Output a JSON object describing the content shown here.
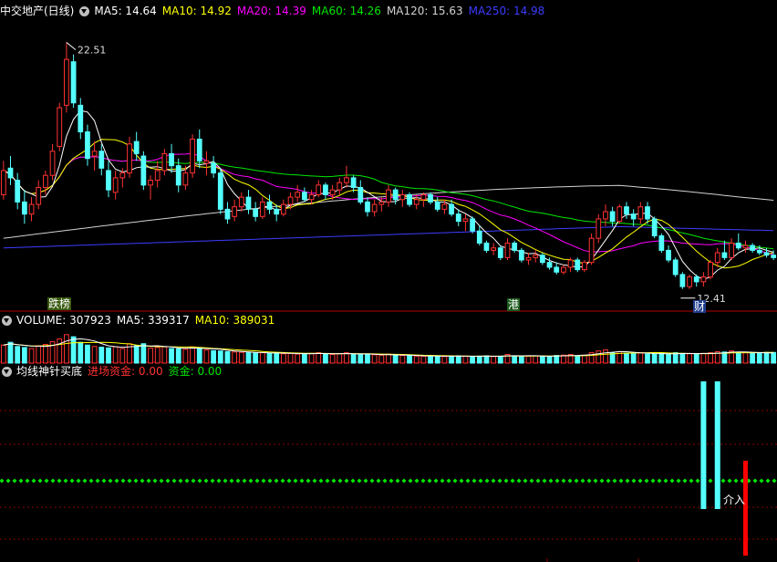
{
  "colors": {
    "up": "#ff3232",
    "down": "#54ffff",
    "grid": "#8b0000",
    "ma5": "#ffffff",
    "ma10": "#ffff00",
    "ma20": "#ff00ff",
    "ma60": "#00e600",
    "ma120": "#d2d2d2",
    "ma250": "#3c3cff",
    "dots": "#00e600"
  },
  "price_panel": {
    "title": "中交地产(日线)",
    "ma5": "MA5: 14.64",
    "ma10": "MA10: 14.92",
    "ma20": "MA20: 14.39",
    "ma60": "MA60: 14.26",
    "ma120": "MA120: 15.63",
    "ma250": "MA250: 14.98",
    "high_label": "22.51",
    "low_label": "12.41",
    "tag1": "跌榜",
    "tag2": "港",
    "tag3": "财"
  },
  "volume_panel": {
    "vol": "VOLUME: 307923",
    "ma5": "MA5: 339317",
    "ma10": "MA10: 389031"
  },
  "indicator_panel": {
    "name": "均线神针买底",
    "in_fund": "进场资金: 0.00",
    "fund": "资金: 0.00",
    "buy_label": "介入"
  },
  "chart_data": [
    {
      "type": "candlestick",
      "title": "中交地产(日线)",
      "ylim": [
        11.5,
        23.5
      ],
      "candles": [
        [
          16.2,
          17.6,
          16.0,
          17.2
        ],
        [
          17.3,
          17.8,
          16.6,
          16.9
        ],
        [
          16.8,
          17.1,
          15.6,
          15.9
        ],
        [
          15.9,
          16.4,
          15.0,
          15.4
        ],
        [
          15.4,
          16.1,
          15.1,
          15.8
        ],
        [
          15.8,
          16.8,
          15.6,
          16.5
        ],
        [
          16.5,
          17.2,
          16.2,
          17.0
        ],
        [
          17.0,
          18.3,
          16.8,
          18.0
        ],
        [
          18.2,
          20.0,
          18.0,
          19.8
        ],
        [
          19.9,
          22.5,
          19.6,
          21.8
        ],
        [
          21.7,
          22.0,
          19.8,
          20.0
        ],
        [
          19.9,
          20.2,
          18.5,
          18.8
        ],
        [
          18.8,
          19.1,
          17.4,
          17.7
        ],
        [
          17.8,
          18.4,
          17.2,
          18.0
        ],
        [
          18.0,
          18.3,
          17.0,
          17.3
        ],
        [
          17.2,
          17.6,
          16.1,
          16.4
        ],
        [
          16.3,
          17.2,
          16.0,
          16.9
        ],
        [
          16.9,
          17.3,
          16.5,
          17.1
        ],
        [
          17.1,
          18.6,
          16.9,
          18.3
        ],
        [
          18.4,
          18.8,
          17.6,
          17.9
        ],
        [
          17.8,
          18.0,
          16.4,
          16.6
        ],
        [
          16.6,
          17.0,
          16.0,
          16.8
        ],
        [
          16.8,
          17.6,
          16.5,
          17.2
        ],
        [
          17.2,
          18.1,
          17.0,
          17.9
        ],
        [
          17.9,
          18.3,
          17.1,
          17.4
        ],
        [
          17.4,
          17.7,
          16.3,
          16.6
        ],
        [
          16.6,
          17.4,
          16.4,
          17.1
        ],
        [
          17.1,
          18.7,
          16.9,
          18.5
        ],
        [
          18.5,
          18.9,
          17.3,
          17.6
        ],
        [
          17.5,
          18.0,
          17.0,
          17.6
        ],
        [
          17.5,
          17.8,
          16.9,
          17.1
        ],
        [
          17.1,
          17.3,
          15.4,
          15.6
        ],
        [
          15.6,
          15.9,
          15.0,
          15.2
        ],
        [
          15.3,
          16.0,
          15.1,
          15.7
        ],
        [
          15.7,
          16.3,
          15.5,
          16.1
        ],
        [
          16.1,
          16.4,
          15.4,
          15.6
        ],
        [
          15.6,
          15.9,
          15.1,
          15.3
        ],
        [
          15.3,
          16.1,
          15.2,
          15.9
        ],
        [
          15.9,
          16.2,
          15.4,
          15.6
        ],
        [
          15.6,
          15.8,
          15.1,
          15.4
        ],
        [
          15.4,
          16.0,
          15.3,
          15.8
        ],
        [
          15.8,
          16.3,
          15.6,
          16.1
        ],
        [
          16.1,
          16.6,
          15.9,
          16.3
        ],
        [
          16.3,
          16.5,
          15.9,
          16.0
        ],
        [
          16.0,
          16.4,
          15.8,
          16.2
        ],
        [
          16.2,
          16.8,
          16.1,
          16.6
        ],
        [
          16.6,
          16.7,
          16.0,
          16.2
        ],
        [
          16.2,
          16.6,
          16.0,
          16.4
        ],
        [
          16.4,
          16.9,
          16.2,
          16.7
        ],
        [
          16.7,
          17.4,
          16.5,
          16.9
        ],
        [
          16.9,
          17.0,
          16.3,
          16.5
        ],
        [
          16.5,
          16.8,
          15.8,
          15.9
        ],
        [
          15.9,
          16.1,
          15.3,
          15.5
        ],
        [
          15.5,
          16.0,
          15.3,
          15.8
        ],
        [
          15.8,
          16.1,
          15.5,
          15.9
        ],
        [
          15.9,
          16.6,
          15.7,
          16.4
        ],
        [
          16.4,
          16.5,
          15.8,
          16.0
        ],
        [
          16.0,
          16.4,
          15.7,
          16.2
        ],
        [
          16.2,
          16.3,
          15.7,
          15.8
        ],
        [
          15.8,
          16.2,
          15.6,
          16.0
        ],
        [
          16.0,
          16.3,
          15.7,
          16.2
        ],
        [
          16.2,
          16.3,
          15.8,
          15.9
        ],
        [
          15.9,
          16.1,
          15.5,
          15.6
        ],
        [
          15.6,
          16.0,
          15.4,
          15.8
        ],
        [
          15.8,
          16.0,
          15.3,
          15.4
        ],
        [
          15.4,
          15.6,
          14.9,
          15.1
        ],
        [
          15.1,
          15.4,
          14.7,
          15.2
        ],
        [
          15.2,
          15.3,
          14.6,
          14.7
        ],
        [
          14.7,
          14.9,
          14.1,
          14.2
        ],
        [
          14.2,
          14.3,
          13.8,
          13.9
        ],
        [
          13.9,
          14.2,
          13.7,
          14.0
        ],
        [
          14.0,
          14.1,
          13.5,
          13.6
        ],
        [
          13.6,
          14.4,
          13.5,
          14.2
        ],
        [
          14.2,
          14.3,
          13.8,
          13.9
        ],
        [
          13.9,
          14.0,
          13.4,
          13.5
        ],
        [
          13.5,
          13.8,
          13.3,
          13.6
        ],
        [
          13.6,
          13.9,
          13.4,
          13.7
        ],
        [
          13.7,
          13.8,
          13.3,
          13.4
        ],
        [
          13.4,
          13.6,
          13.1,
          13.2
        ],
        [
          13.2,
          13.4,
          12.9,
          13.0
        ],
        [
          13.0,
          13.3,
          12.9,
          13.2
        ],
        [
          13.2,
          13.6,
          13.0,
          13.5
        ],
        [
          13.5,
          13.6,
          13.0,
          13.1
        ],
        [
          13.1,
          13.5,
          13.0,
          13.4
        ],
        [
          13.4,
          14.6,
          13.3,
          14.4
        ],
        [
          14.4,
          15.4,
          14.2,
          15.2
        ],
        [
          15.2,
          15.8,
          14.9,
          15.5
        ],
        [
          15.5,
          15.7,
          14.9,
          15.1
        ],
        [
          15.1,
          15.8,
          15.0,
          15.7
        ],
        [
          15.7,
          15.9,
          15.2,
          15.4
        ],
        [
          15.4,
          15.6,
          14.9,
          15.2
        ],
        [
          15.2,
          15.9,
          15.0,
          15.7
        ],
        [
          15.7,
          15.9,
          15.0,
          15.2
        ],
        [
          15.2,
          15.3,
          14.4,
          14.5
        ],
        [
          14.5,
          14.6,
          13.8,
          13.9
        ],
        [
          13.9,
          14.1,
          13.4,
          13.5
        ],
        [
          13.5,
          13.6,
          12.8,
          12.9
        ],
        [
          12.9,
          13.0,
          12.3,
          12.4
        ],
        [
          12.4,
          12.9,
          12.3,
          12.8
        ],
        [
          12.8,
          12.9,
          12.4,
          12.6
        ],
        [
          12.6,
          13.0,
          12.4,
          12.8
        ],
        [
          12.8,
          13.5,
          12.7,
          13.4
        ],
        [
          13.4,
          14.0,
          13.2,
          13.8
        ],
        [
          13.8,
          14.3,
          13.5,
          13.6
        ],
        [
          13.6,
          14.4,
          13.5,
          14.2
        ],
        [
          14.2,
          14.6,
          13.9,
          14.0
        ],
        [
          14.0,
          14.3,
          13.8,
          14.1
        ],
        [
          14.1,
          14.2,
          13.8,
          13.9
        ],
        [
          13.9,
          14.1,
          13.7,
          13.8
        ],
        [
          13.8,
          14.0,
          13.6,
          13.7
        ],
        [
          13.7,
          13.9,
          13.5,
          13.6
        ]
      ],
      "markers": {
        "high": 22.51,
        "low": 12.41
      }
    },
    {
      "type": "bar",
      "title": "VOLUME",
      "ylim": [
        0,
        1000000
      ],
      "values": [
        520000,
        600000,
        480000,
        450000,
        420000,
        500000,
        540000,
        620000,
        700000,
        820000,
        760000,
        600000,
        520000,
        480000,
        460000,
        440000,
        470000,
        420000,
        560000,
        500000,
        560000,
        430000,
        450000,
        470000,
        420000,
        410000,
        400000,
        470000,
        440000,
        380000,
        360000,
        350000,
        330000,
        320000,
        310000,
        300000,
        290000,
        300000,
        280000,
        290000,
        270000,
        280000,
        260000,
        270000,
        280000,
        300000,
        260000,
        250000,
        270000,
        300000,
        260000,
        250000,
        240000,
        240000,
        230000,
        260000,
        220000,
        220000,
        210000,
        200000,
        200000,
        210000,
        200000,
        190000,
        200000,
        210000,
        200000,
        190000,
        200000,
        210000,
        190000,
        200000,
        250000,
        210000,
        200000,
        200000,
        210000,
        200000,
        190000,
        220000,
        230000,
        250000,
        210000,
        230000,
        300000,
        350000,
        380000,
        300000,
        330000,
        290000,
        270000,
        300000,
        260000,
        260000,
        280000,
        260000,
        300000,
        280000,
        270000,
        260000,
        280000,
        300000,
        330000,
        320000,
        350000,
        310000,
        300000,
        290000,
        280000,
        310000,
        307923
      ],
      "ma5": [
        339317
      ],
      "ma10": [
        389031
      ]
    },
    {
      "type": "bar",
      "title": "均线神针买底",
      "ylim": [
        0,
        2
      ],
      "dotted_level": 1,
      "signals": [
        {
          "index": 100,
          "kind": "cyan",
          "value": 2
        },
        {
          "index": 102,
          "kind": "cyan",
          "value": 2
        },
        {
          "index": 106,
          "kind": "red",
          "value": 2
        }
      ],
      "in_fund": 0.0,
      "fund": 0.0
    }
  ]
}
